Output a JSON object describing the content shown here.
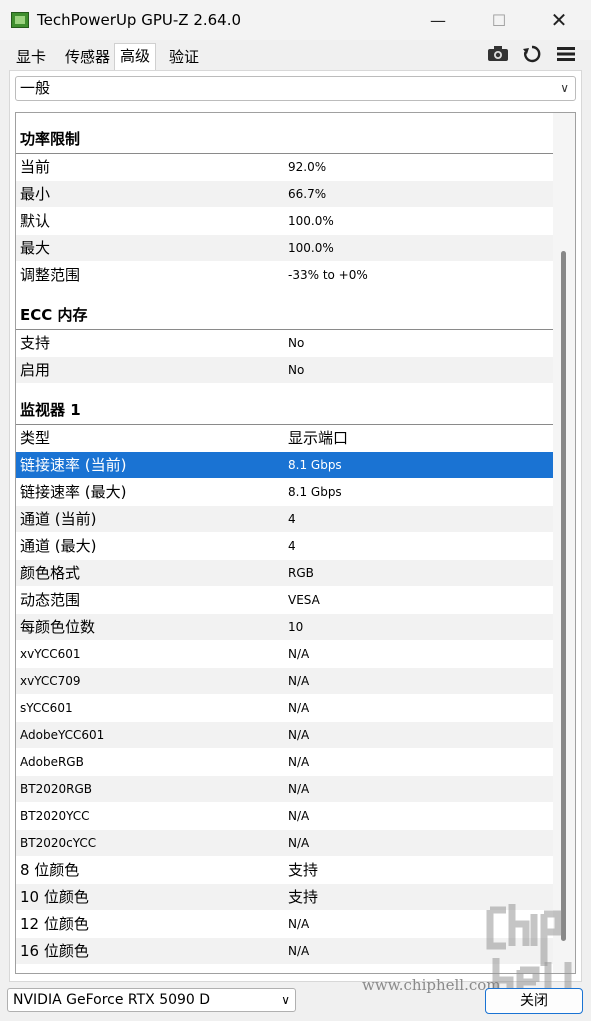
{
  "window": {
    "title": "TechPowerUp GPU-Z 2.64.0",
    "minimize_glyph": "—",
    "maximize_glyph": "☐",
    "close_glyph": "✕"
  },
  "tabs": [
    {
      "label": "显卡"
    },
    {
      "label": "传感器"
    },
    {
      "label": "高级"
    },
    {
      "label": "验证"
    }
  ],
  "active_tab": "高级",
  "toolbar_icons": [
    "camera-icon",
    "refresh-icon",
    "menu-icon"
  ],
  "category_dropdown": {
    "value": "一般"
  },
  "sections": {
    "power": {
      "title": "功率限制",
      "rows": [
        {
          "k": "当前",
          "v": "92.0%"
        },
        {
          "k": "最小",
          "v": "66.7%"
        },
        {
          "k": "默认",
          "v": "100.0%"
        },
        {
          "k": "最大",
          "v": "100.0%"
        },
        {
          "k": "调整范围",
          "v": "-33% to +0%"
        }
      ]
    },
    "ecc": {
      "title": "ECC 内存",
      "rows": [
        {
          "k": "支持",
          "v": "No"
        },
        {
          "k": "启用",
          "v": "No"
        }
      ]
    },
    "monitor": {
      "title": "监视器 1",
      "rows": [
        {
          "k": "类型",
          "v": "显示端口"
        },
        {
          "k": "链接速率 (当前)",
          "v": "8.1 Gbps"
        },
        {
          "k": "链接速率 (最大)",
          "v": "8.1 Gbps"
        },
        {
          "k": "通道 (当前)",
          "v": "4"
        },
        {
          "k": "通道 (最大)",
          "v": "4"
        },
        {
          "k": "颜色格式",
          "v": "RGB"
        },
        {
          "k": "动态范围",
          "v": "VESA"
        },
        {
          "k": "每颜色位数",
          "v": "10"
        },
        {
          "k": "xvYCC601",
          "v": "N/A"
        },
        {
          "k": "xvYCC709",
          "v": "N/A"
        },
        {
          "k": "sYCC601",
          "v": "N/A"
        },
        {
          "k": "AdobeYCC601",
          "v": "N/A"
        },
        {
          "k": "AdobeRGB",
          "v": "N/A"
        },
        {
          "k": "BT2020RGB",
          "v": "N/A"
        },
        {
          "k": "BT2020YCC",
          "v": "N/A"
        },
        {
          "k": "BT2020cYCC",
          "v": "N/A"
        },
        {
          "k": "8 位颜色",
          "v": "支持"
        },
        {
          "k": "10 位颜色",
          "v": "支持"
        },
        {
          "k": "12 位颜色",
          "v": "N/A"
        },
        {
          "k": "16 位颜色",
          "v": "N/A"
        }
      ]
    }
  },
  "selected_row": "链接速率 (当前)",
  "gpu_select": {
    "value": "NVIDIA GeForce RTX 5090 D"
  },
  "close_button": {
    "label": "关闭"
  },
  "watermark": {
    "url": "www.chiphell.com",
    "logo": "chip hell"
  },
  "colors": {
    "selection": "#1a73d3",
    "alt_row": "#f2f2f2"
  }
}
